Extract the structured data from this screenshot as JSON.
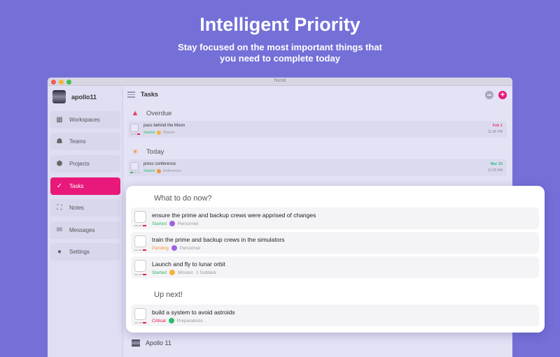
{
  "hero": {
    "title": "Intelligent Priority",
    "subtitle": "Stay focused on the most important things that you need to complete today"
  },
  "window": {
    "title": "Nural"
  },
  "sidebar": {
    "user": "apollo11",
    "items": [
      {
        "label": "Workspaces",
        "icon": "grid-icon",
        "active": false
      },
      {
        "label": "Teams",
        "icon": "team-icon",
        "active": false
      },
      {
        "label": "Projects",
        "icon": "cube-icon",
        "active": false
      },
      {
        "label": "Tasks",
        "icon": "check-icon",
        "active": true
      },
      {
        "label": "Notes",
        "icon": "notes-icon",
        "active": false
      },
      {
        "label": "Messages",
        "icon": "mail-icon",
        "active": false
      },
      {
        "label": "Settings",
        "icon": "more-icon",
        "active": false
      }
    ]
  },
  "main": {
    "title": "Tasks",
    "sections": [
      {
        "label": "Overdue",
        "tasks": [
          {
            "title": "pass behind the Moon",
            "status": "Started",
            "project": "Mission",
            "date": "Feb 1",
            "time": "11:45 PM"
          }
        ]
      },
      {
        "label": "Today",
        "tasks": [
          {
            "title": "press conference",
            "status": "Started",
            "project": "References",
            "date": "Mar 10",
            "time": "11:55 AM"
          }
        ]
      }
    ],
    "bottom_project": "Apollo 11"
  },
  "card": {
    "now_heading": "What to do now?",
    "now_tasks": [
      {
        "title": "ensure the prime and backup crews were apprised of changes",
        "status": "Started",
        "project": "Personnel",
        "extra": ""
      },
      {
        "title": "train the prime and backup crews in the simulators",
        "status": "Pending",
        "project": "Personnel",
        "extra": ""
      },
      {
        "title": "Launch and fly to lunar orbit",
        "status": "Started",
        "project": "Mission",
        "extra": "1 Subtask"
      }
    ],
    "next_heading": "Up next!",
    "next_tasks": [
      {
        "title": "build a system to avoid astroids",
        "status": "Critical",
        "project": "Preparations",
        "extra": ""
      }
    ]
  },
  "colors": {
    "background": "#7470d8",
    "accent": "#e8197a",
    "started": "#2ebd6b",
    "pending": "#f5953a",
    "critical": "#e8194e",
    "overdue_date": "#e0407a",
    "today_date": "#2ebd8b"
  }
}
